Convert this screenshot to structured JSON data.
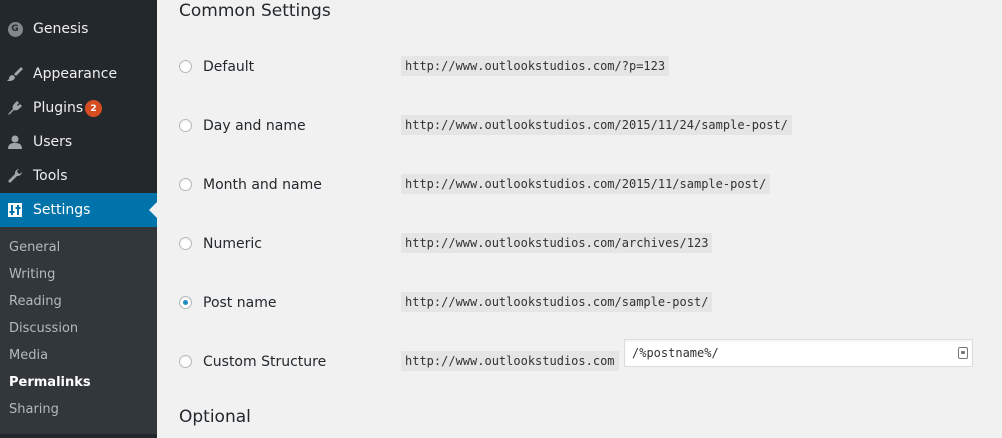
{
  "sidebar": {
    "menu": [
      {
        "label": "Genesis",
        "icon": "genesis-logo-icon"
      },
      {
        "label": "Appearance",
        "icon": "paintbrush-icon"
      },
      {
        "label": "Plugins",
        "icon": "plug-icon",
        "badge": "2"
      },
      {
        "label": "Users",
        "icon": "user-icon"
      },
      {
        "label": "Tools",
        "icon": "wrench-icon"
      },
      {
        "label": "Settings",
        "icon": "settings-icon",
        "active": true
      }
    ],
    "submenu": [
      "General",
      "Writing",
      "Reading",
      "Discussion",
      "Media",
      "Permalinks",
      "Sharing"
    ],
    "current_submenu": "Permalinks"
  },
  "main": {
    "common_settings_title": "Common Settings",
    "options": [
      {
        "label": "Default",
        "url": "http://www.outlookstudios.com/?p=123",
        "checked": false
      },
      {
        "label": "Day and name",
        "url": "http://www.outlookstudios.com/2015/11/24/sample-post/",
        "checked": false
      },
      {
        "label": "Month and name",
        "url": "http://www.outlookstudios.com/2015/11/sample-post/",
        "checked": false
      },
      {
        "label": "Numeric",
        "url": "http://www.outlookstudios.com/archives/123",
        "checked": false
      },
      {
        "label": "Post name",
        "url": "http://www.outlookstudios.com/sample-post/",
        "checked": true
      },
      {
        "label": "Custom Structure",
        "url": "http://www.outlookstudios.com",
        "checked": false,
        "input_value": "/%postname%/"
      }
    ],
    "optional_title": "Optional"
  },
  "colors": {
    "sidebar_bg": "#23282d",
    "submenu_bg": "#32373c",
    "active_bg": "#0073aa",
    "badge_bg": "#d54e21",
    "content_bg": "#f1f1f1",
    "radio_checked": "#1e8cbe"
  }
}
